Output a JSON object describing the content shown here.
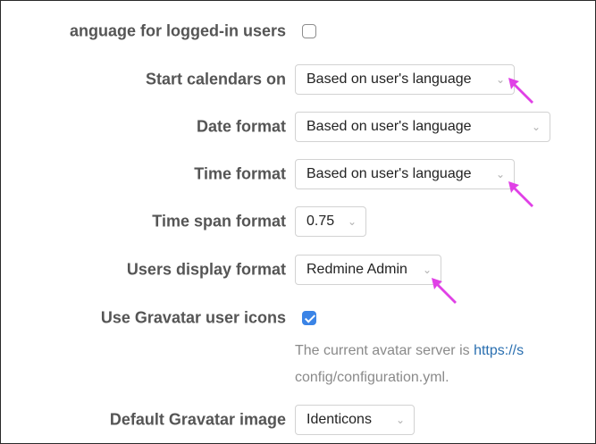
{
  "settings": {
    "language_logged_in": {
      "label": "anguage for logged-in users",
      "checked": false
    },
    "start_calendars": {
      "label": "Start calendars on",
      "value": "Based on user's language"
    },
    "date_format": {
      "label": "Date format",
      "value": "Based on user's language"
    },
    "time_format": {
      "label": "Time format",
      "value": "Based on user's language"
    },
    "time_span_format": {
      "label": "Time span format",
      "value": "0.75"
    },
    "users_display_format": {
      "label": "Users display format",
      "value": "Redmine Admin"
    },
    "use_gravatar": {
      "label": "Use Gravatar user icons",
      "checked": true
    },
    "gravatar_info": {
      "prefix": "The current avatar server is ",
      "link": "https://s",
      "line2": "config/configuration.yml."
    },
    "default_gravatar": {
      "label": "Default Gravatar image",
      "value": "Identicons"
    }
  },
  "colors": {
    "accent_checkbox": "#3b84e6",
    "cursor": "#e040e6",
    "label_text": "#555555",
    "link": "#2a6fb0"
  },
  "icons": {
    "chevron": "chevron-down-icon",
    "cursor": "mouse-pointer-icon"
  }
}
